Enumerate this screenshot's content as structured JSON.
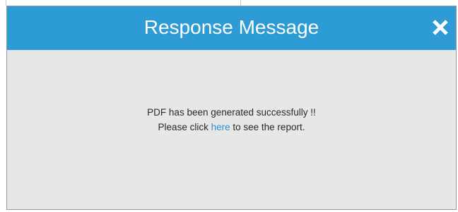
{
  "dialog": {
    "title": "Response Message",
    "close_icon": "close-icon",
    "message_line1": "PDF has been generated successfully !!",
    "message_line2_prefix": "Please click",
    "message_line2_link": "here",
    "message_line2_suffix": "to see the report."
  },
  "colors": {
    "header_bg": "#2d9bd6",
    "body_bg": "#e7e7e7",
    "link": "#2a8ed0"
  }
}
